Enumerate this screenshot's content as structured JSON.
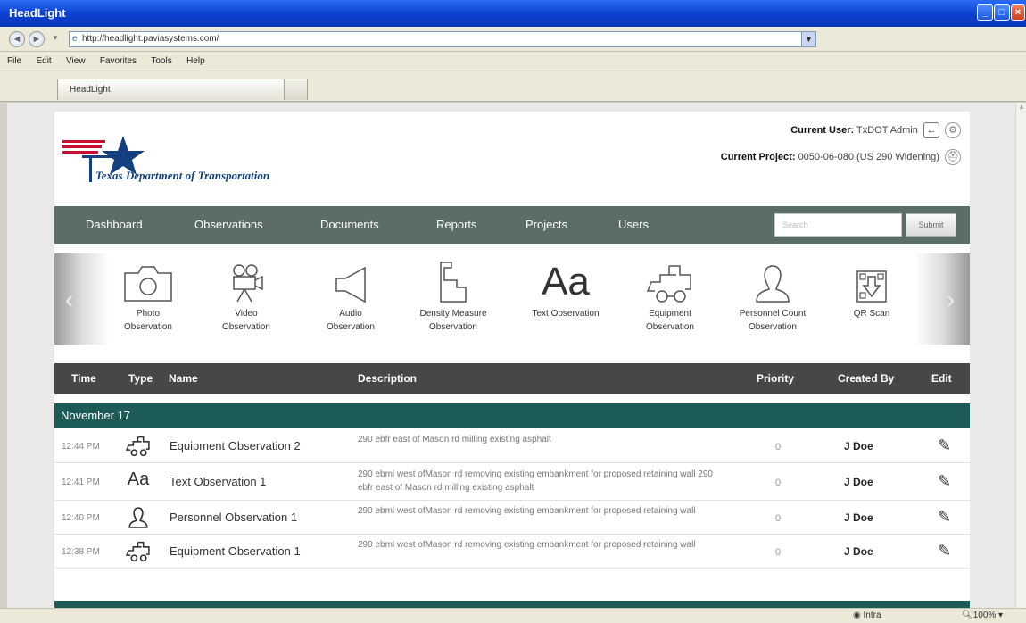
{
  "window": {
    "title": "HeadLight"
  },
  "browser": {
    "url": "http://headlight.paviasystems.com/",
    "menu": [
      "File",
      "Edit",
      "View",
      "Favorites",
      "Tools",
      "Help"
    ],
    "tab": "HeadLight",
    "status_zone": "Intra",
    "zoom": "100%"
  },
  "header": {
    "org_name": "Texas Department of Transportation",
    "user_label": "Current User:",
    "user_value": "TxDOT Admin",
    "project_label": "Current Project:",
    "project_value": "0050-06-080 (US 290 Widening)"
  },
  "nav": {
    "items": [
      "Dashboard",
      "Observations",
      "Documents",
      "Reports",
      "Projects",
      "Users"
    ],
    "search_placeholder": "Search",
    "submit_label": "Submit"
  },
  "observation_types": [
    {
      "icon": "camera-icon",
      "line1": "Photo",
      "line2": "Observation"
    },
    {
      "icon": "video-camera-icon",
      "line1": "Video",
      "line2": "Observation"
    },
    {
      "icon": "speaker-icon",
      "line1": "Audio",
      "line2": "Observation"
    },
    {
      "icon": "density-gauge-icon",
      "line1": "Density Measure",
      "line2": "Observation"
    },
    {
      "icon": "text-aa-icon",
      "glyph": "Aa",
      "line1": "Text Observation",
      "line2": ""
    },
    {
      "icon": "excavator-icon",
      "line1": "Equipment",
      "line2": "Observation"
    },
    {
      "icon": "person-icon",
      "line1": "Personnel Count",
      "line2": "Observation"
    },
    {
      "icon": "qr-scan-icon",
      "line1": "QR Scan",
      "line2": ""
    }
  ],
  "table": {
    "headers": {
      "time": "Time",
      "type": "Type",
      "name": "Name",
      "description": "Description",
      "priority": "Priority",
      "created_by": "Created By",
      "edit": "Edit"
    },
    "group": "November 17",
    "rows": [
      {
        "time": "12:44 PM",
        "type_icon": "excavator-icon",
        "name": "Equipment Observation 2",
        "description": "290 ebfr east of Mason rd milling existing asphalt",
        "priority": "0",
        "created_by": "J Doe"
      },
      {
        "time": "12:41 PM",
        "type_icon": "text-aa-icon",
        "type_glyph": "Aa",
        "name": "Text Observation 1",
        "description": "290 ebml west ofMason rd removing existing embankment for proposed retaining wall 290 ebfr east of Mason rd milling existing asphalt",
        "priority": "0",
        "created_by": "J Doe"
      },
      {
        "time": "12:40 PM",
        "type_icon": "person-icon",
        "name": "Personnel Observation 1",
        "description": "290 ebml west ofMason rd removing existing embankment for proposed retaining wall",
        "priority": "0",
        "created_by": "J Doe"
      },
      {
        "time": "12:38 PM",
        "type_icon": "excavator-icon",
        "name": "Equipment Observation 1",
        "description": "290 ebml west ofMason rd removing existing embankment for proposed retaining wall",
        "priority": "0",
        "created_by": "J Doe"
      }
    ]
  }
}
